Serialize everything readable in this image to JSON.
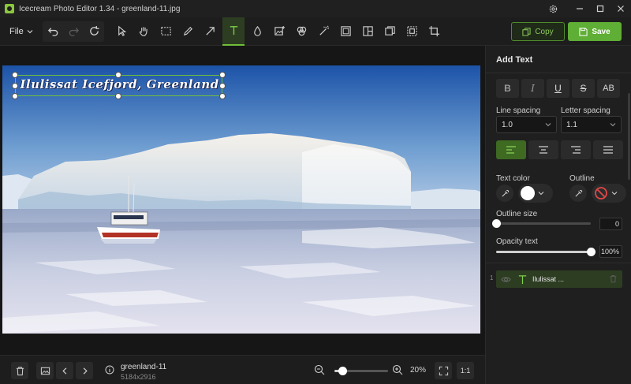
{
  "window": {
    "title": "Icecream Photo Editor 1.34 - greenland-11.jpg",
    "icons": [
      "settings-icon",
      "minimize-icon",
      "maximize-icon",
      "close-icon"
    ]
  },
  "toolbar": {
    "file_label": "File",
    "copy_label": "Copy",
    "save_label": "Save",
    "active_tool": "text",
    "tools": [
      "select-arrow",
      "hand",
      "crop-rectangle",
      "pencil",
      "arrow",
      "text",
      "blur-drop",
      "image-add",
      "color-layers",
      "magic-wand",
      "frame",
      "collage",
      "overlay",
      "resize",
      "crop"
    ],
    "accent_color": "#6fbf3a"
  },
  "canvas": {
    "overlay_text": "Ilulissat Icefjord, Greenland"
  },
  "bottom": {
    "file_name": "greenland-11",
    "file_dims": "5184x2916",
    "zoom_label": "20%",
    "zoom_fraction": 0.15,
    "fit_label": "1:1"
  },
  "panel": {
    "title": "Add Text",
    "format_buttons": [
      "B",
      "I",
      "U",
      "S",
      "AB"
    ],
    "line_spacing_label": "Line spacing",
    "line_spacing_value": "1.0",
    "letter_spacing_label": "Letter spacing",
    "letter_spacing_value": "1.1",
    "active_alignment": "left",
    "text_color_label": "Text color",
    "text_color": "#ffffff",
    "outline_label": "Outline",
    "outline_size_label": "Outline size",
    "outline_size_value": "0",
    "outline_size_fraction": 0.0,
    "opacity_label": "Opacity text",
    "opacity_value": "100%",
    "opacity_fraction": 1.0,
    "layer_index": "1",
    "layer_name": "Ilulissat ..."
  }
}
